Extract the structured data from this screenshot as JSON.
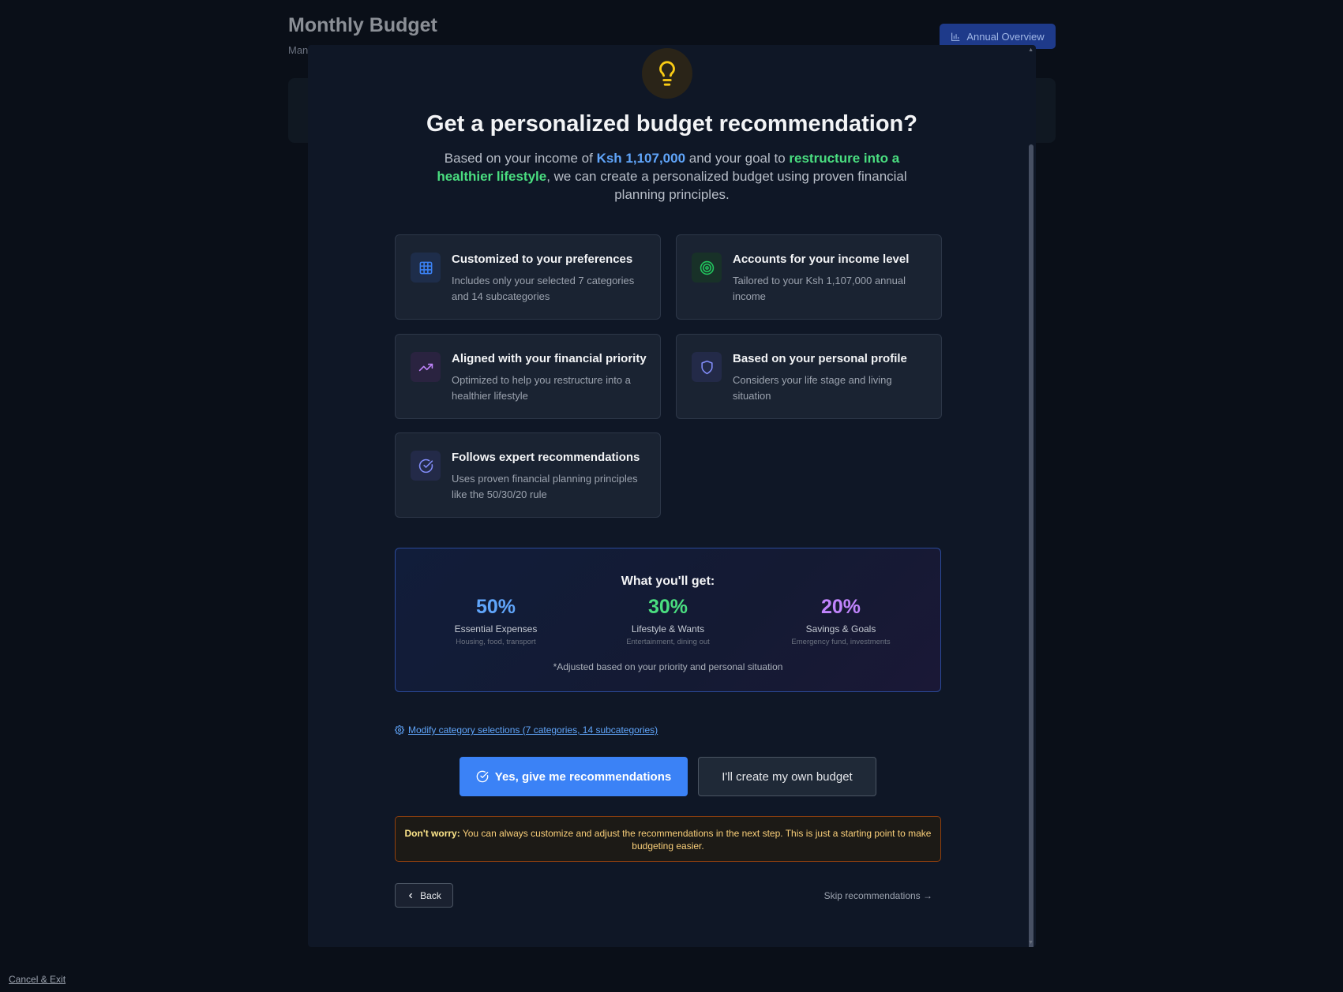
{
  "background": {
    "page_title": "Monthly Budget",
    "page_subtitle": "Man",
    "annual_overview_label": "Annual Overview",
    "cancel_exit_label": "Cancel & Exit"
  },
  "modal": {
    "title": "Get a personalized budget recommendation?",
    "intro": {
      "prefix": "Based on your income of ",
      "income": "Ksh 1,107,000",
      "middle": " and your goal to ",
      "goal": "restructure into a healthier lifestyle",
      "suffix": ", we can create a personalized budget using proven financial planning principles."
    },
    "features": [
      {
        "title": "Customized to your preferences",
        "desc": "Includes only your selected 7 categories and 14 subcategories",
        "icon": "grid-icon",
        "color": "#3b82f6"
      },
      {
        "title": "Accounts for your income level",
        "desc": "Tailored to your Ksh 1,107,000 annual income",
        "icon": "target-icon",
        "color": "#22c55e"
      },
      {
        "title": "Aligned with your financial priority",
        "desc": "Optimized to help you restructure into a healthier lifestyle",
        "icon": "trending-up-icon",
        "color": "#c084fc"
      },
      {
        "title": "Based on your personal profile",
        "desc": "Considers your life stage and living situation",
        "icon": "shield-icon",
        "color": "#818cf8"
      },
      {
        "title": "Follows expert recommendations",
        "desc": "Uses proven financial planning principles like the 50/30/20 rule",
        "icon": "check-circle-icon",
        "color": "#818cf8"
      }
    ],
    "what_you_get": {
      "heading": "What you'll get:",
      "items": [
        {
          "value": "50%",
          "label": "Essential Expenses",
          "sub": "Housing, food, transport",
          "color": "#60a5fa"
        },
        {
          "value": "30%",
          "label": "Lifestyle & Wants",
          "sub": "Entertainment, dining out",
          "color": "#4ade80"
        },
        {
          "value": "20%",
          "label": "Savings & Goals",
          "sub": "Emergency fund, investments",
          "color": "#c084fc"
        }
      ],
      "note": "*Adjusted based on your priority and personal situation"
    },
    "modify_link": "Modify category selections (7 categories, 14 subcategories)",
    "yes_button": "Yes, give me recommendations",
    "own_button": "I'll create my own budget",
    "worry": {
      "bold": "Don't worry:",
      "text": " You can always customize and adjust the recommendations in the next step. This is just a starting point to make budgeting easier."
    },
    "back_button": "Back",
    "skip_link": "Skip recommendations →"
  }
}
